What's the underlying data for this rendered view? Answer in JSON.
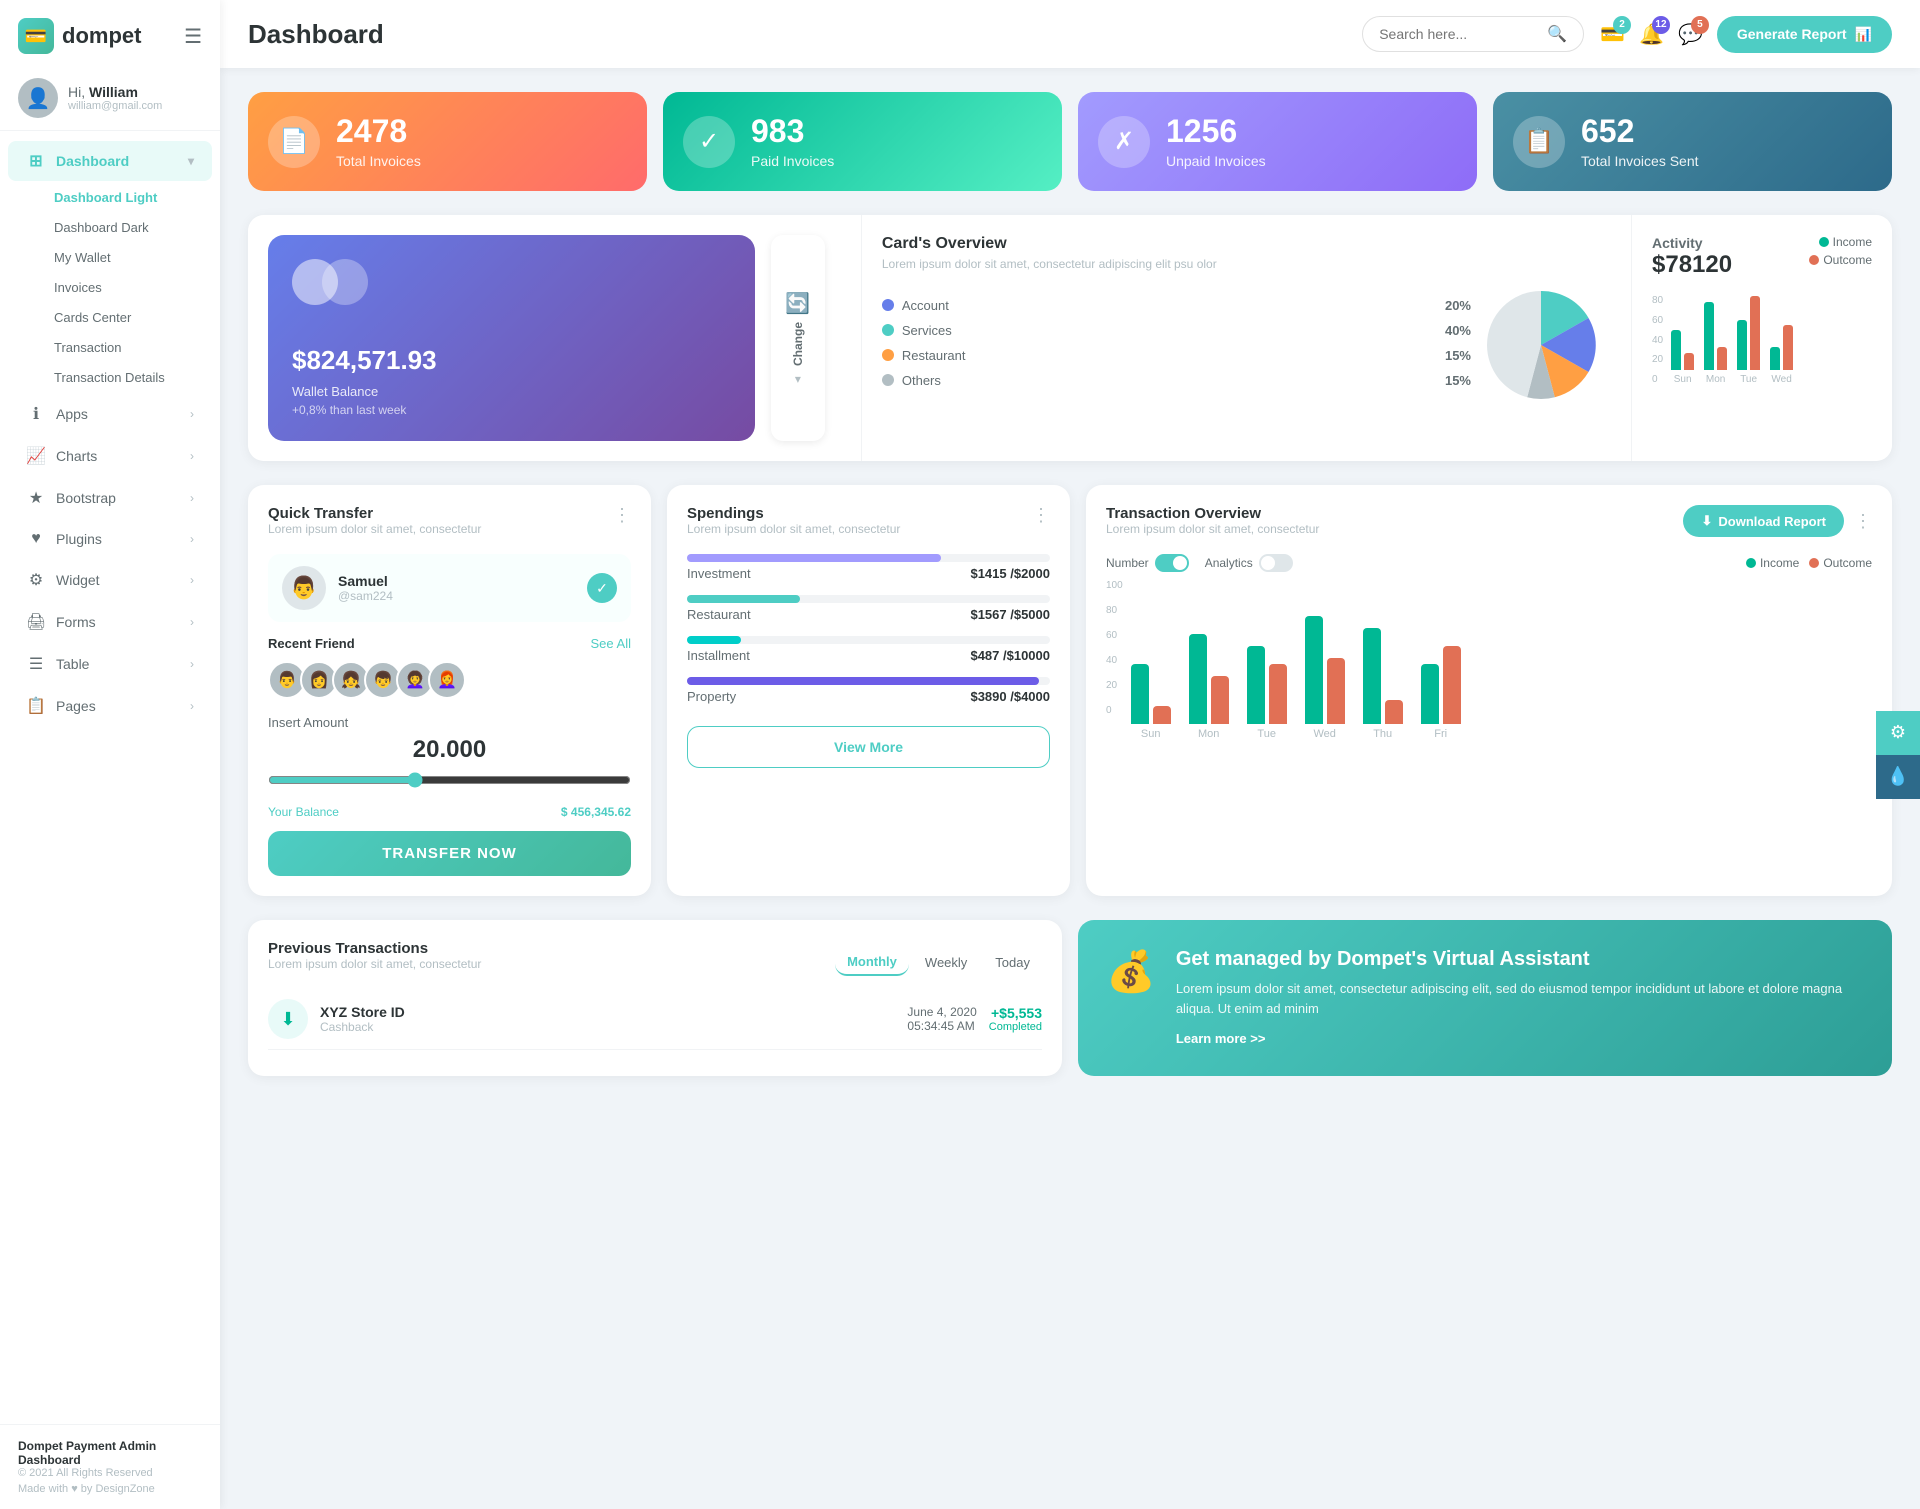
{
  "sidebar": {
    "logo": "dompet",
    "logo_icon": "💳",
    "hamburger": "☰",
    "user": {
      "hi": "Hi,",
      "name": "William",
      "email": "william@gmail.com"
    },
    "nav": [
      {
        "id": "dashboard",
        "label": "Dashboard",
        "icon": "⊞",
        "active": true,
        "arrow": "▾",
        "children": [
          {
            "label": "Dashboard Light",
            "active": true
          },
          {
            "label": "Dashboard Dark",
            "active": false
          },
          {
            "label": "My Wallet",
            "active": false
          },
          {
            "label": "Invoices",
            "active": false
          },
          {
            "label": "Cards Center",
            "active": false
          },
          {
            "label": "Transaction",
            "active": false
          },
          {
            "label": "Transaction Details",
            "active": false
          }
        ]
      },
      {
        "id": "apps",
        "label": "Apps",
        "icon": "ℹ",
        "arrow": "›"
      },
      {
        "id": "charts",
        "label": "Charts",
        "icon": "📈",
        "arrow": "›"
      },
      {
        "id": "bootstrap",
        "label": "Bootstrap",
        "icon": "★",
        "arrow": "›"
      },
      {
        "id": "plugins",
        "label": "Plugins",
        "icon": "♥",
        "arrow": "›"
      },
      {
        "id": "widget",
        "label": "Widget",
        "icon": "⚙",
        "arrow": "›"
      },
      {
        "id": "forms",
        "label": "Forms",
        "icon": "🖨",
        "arrow": "›"
      },
      {
        "id": "table",
        "label": "Table",
        "icon": "☰",
        "arrow": "›"
      },
      {
        "id": "pages",
        "label": "Pages",
        "icon": "📋",
        "arrow": "›"
      }
    ],
    "footer": {
      "title": "Dompet Payment Admin Dashboard",
      "copy": "© 2021 All Rights Reserved",
      "made": "Made with ♥ by DesignZone"
    }
  },
  "topbar": {
    "title": "Dashboard",
    "search_placeholder": "Search here...",
    "badges": {
      "wallet": "2",
      "bell": "12",
      "chat": "5"
    },
    "generate_btn": "Generate Report"
  },
  "stats": [
    {
      "value": "2478",
      "label": "Total Invoices",
      "icon": "📄",
      "color": "orange"
    },
    {
      "value": "983",
      "label": "Paid Invoices",
      "icon": "✓",
      "color": "green"
    },
    {
      "value": "1256",
      "label": "Unpaid Invoices",
      "icon": "✗",
      "color": "purple"
    },
    {
      "value": "652",
      "label": "Total Invoices Sent",
      "icon": "📋",
      "color": "teal"
    }
  ],
  "wallet": {
    "balance": "$824,571.93",
    "label": "Wallet Balance",
    "change": "+0,8% than last week",
    "change_btn": "Change"
  },
  "cards_overview": {
    "title": "Card's Overview",
    "subtitle": "Lorem ipsum dolor sit amet, consectetur adipiscing elit psu olor",
    "categories": [
      {
        "label": "Account",
        "pct": "20%",
        "color": "#667eea"
      },
      {
        "label": "Services",
        "pct": "40%",
        "color": "#4ecdc4"
      },
      {
        "label": "Restaurant",
        "pct": "15%",
        "color": "#ff9f43"
      },
      {
        "label": "Others",
        "pct": "15%",
        "color": "#b2bec3"
      }
    ]
  },
  "activity": {
    "title": "Activity",
    "amount": "$78120",
    "legend": [
      {
        "label": "Income",
        "color": "#00b894"
      },
      {
        "label": "Outcome",
        "color": "#e17055"
      }
    ],
    "y_labels": [
      "80",
      "60",
      "40",
      "20",
      "0"
    ],
    "bars": [
      {
        "day": "Sun",
        "income": 35,
        "outcome": 15
      },
      {
        "day": "Mon",
        "income": 60,
        "outcome": 20
      },
      {
        "day": "Tue",
        "income": 45,
        "outcome": 65
      },
      {
        "day": "Wed",
        "income": 20,
        "outcome": 40
      }
    ]
  },
  "quick_transfer": {
    "title": "Quick Transfer",
    "subtitle": "Lorem ipsum dolor sit amet, consectetur",
    "selected_user": {
      "name": "Samuel",
      "handle": "@sam224"
    },
    "recent_friend_label": "Recent Friend",
    "see_all": "See All",
    "friends": [
      "👨",
      "👩",
      "👧",
      "👦",
      "👩‍🦱",
      "👩‍🦰"
    ],
    "insert_amount_label": "Insert Amount",
    "amount": "20.000",
    "your_balance_label": "Your Balance",
    "balance": "$ 456,345.62",
    "transfer_btn": "TRANSFER NOW"
  },
  "spendings": {
    "title": "Spendings",
    "subtitle": "Lorem ipsum dolor sit amet, consectetur",
    "items": [
      {
        "label": "Investment",
        "current": "$1415",
        "max": "$2000",
        "pct": 70,
        "color": "#a29bfe"
      },
      {
        "label": "Restaurant",
        "current": "$1567",
        "max": "$5000",
        "pct": 31,
        "color": "#4ecdc4"
      },
      {
        "label": "Installment",
        "current": "$487",
        "max": "$10000",
        "pct": 15,
        "color": "#00cec9"
      },
      {
        "label": "Property",
        "current": "$3890",
        "max": "$4000",
        "pct": 97,
        "color": "#6c5ce7"
      }
    ],
    "view_more": "View More"
  },
  "transaction_overview": {
    "title": "Transaction Overview",
    "subtitle": "Lorem ipsum dolor sit amet, consectetur",
    "download_btn": "Download Report",
    "toggles": [
      {
        "label": "Number",
        "on": true
      },
      {
        "label": "Analytics",
        "on": false
      }
    ],
    "legend": [
      {
        "label": "Income",
        "color": "#00b894"
      },
      {
        "label": "Outcome",
        "color": "#e17055"
      }
    ],
    "y_labels": [
      "100",
      "80",
      "60",
      "40",
      "20",
      "0"
    ],
    "bars": [
      {
        "day": "Sun",
        "income": 50,
        "outcome": 15
      },
      {
        "day": "Mon",
        "income": 75,
        "outcome": 40
      },
      {
        "day": "Tue",
        "income": 65,
        "outcome": 50
      },
      {
        "day": "Wed",
        "income": 90,
        "outcome": 55
      },
      {
        "day": "Thu",
        "income": 80,
        "outcome": 20
      },
      {
        "day": "Fri",
        "income": 50,
        "outcome": 65
      }
    ]
  },
  "prev_transactions": {
    "title": "Previous Transactions",
    "subtitle": "Lorem ipsum dolor sit amet, consectetur",
    "tabs": [
      "Monthly",
      "Weekly",
      "Today"
    ],
    "active_tab": "Monthly",
    "items": [
      {
        "icon": "⬇",
        "icon_color": "green",
        "name": "XYZ Store ID",
        "type": "Cashback",
        "date": "June 4, 2020",
        "time": "05:34:45 AM",
        "amount": "+$5,553",
        "status": "Completed"
      }
    ]
  },
  "virtual_assistant": {
    "title": "Get managed by Dompet's Virtual Assistant",
    "text": "Lorem ipsum dolor sit amet, consectetur adipiscing elit, sed do eiusmod tempor incididunt ut labore et dolore magna aliqua. Ut enim ad minim",
    "link": "Learn more >>",
    "icon": "💰"
  }
}
